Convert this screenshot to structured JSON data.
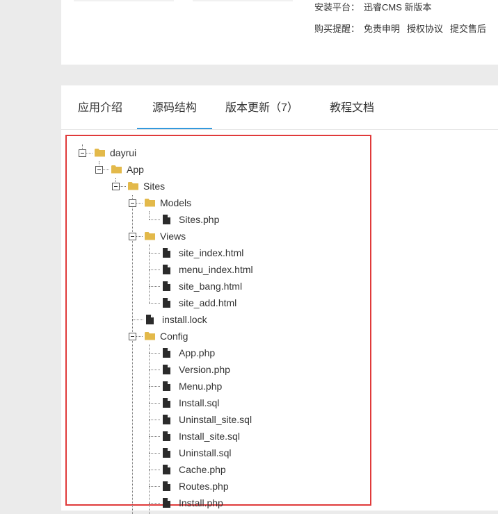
{
  "info": {
    "platform_label": "安装平台：",
    "platform_value": "迅睿CMS 新版本",
    "reminder_label": "购买提醒：",
    "reminder_links": [
      "免责申明",
      "授权协议",
      "提交售后"
    ]
  },
  "tabs": [
    {
      "label": "应用介绍"
    },
    {
      "label": "源码结构"
    },
    {
      "label": "版本更新（7）"
    },
    {
      "label": "教程文档"
    }
  ],
  "tree": {
    "dayrui": "dayrui",
    "app": "App",
    "sites": "Sites",
    "models": "Models",
    "models_sites_php": "Sites.php",
    "views": "Views",
    "views_files": [
      "site_index.html",
      "menu_index.html",
      "site_bang.html",
      "site_add.html"
    ],
    "install_lock": "install.lock",
    "config": "Config",
    "config_files": [
      "App.php",
      "Version.php",
      "Menu.php",
      "Install.sql",
      "Uninstall_site.sql",
      "Install_site.sql",
      "Uninstall.sql",
      "Cache.php",
      "Routes.php",
      "Install.php"
    ]
  },
  "colors": {
    "folder": "#e3b94a",
    "file": "#2b2b2b",
    "accent": "#3399dd",
    "highlight": "#e03a3a"
  }
}
